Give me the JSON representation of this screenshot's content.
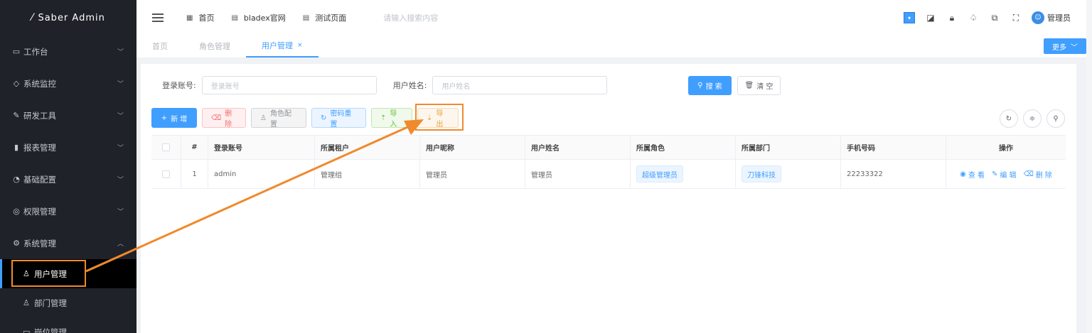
{
  "app": {
    "title": "Saber Admin"
  },
  "sidebar": {
    "items": [
      {
        "label": "工作台",
        "icon": "monitor-icon"
      },
      {
        "label": "系统监控",
        "icon": "shield-icon"
      },
      {
        "label": "研发工具",
        "icon": "wrench-icon"
      },
      {
        "label": "报表管理",
        "icon": "bar-chart-icon"
      },
      {
        "label": "基础配置",
        "icon": "config-icon"
      },
      {
        "label": "权限管理",
        "icon": "lock-icon"
      },
      {
        "label": "系统管理",
        "icon": "gear-icon"
      }
    ],
    "sub_items": [
      {
        "label": "用户管理",
        "icon": "user-icon"
      },
      {
        "label": "部门管理",
        "icon": "team-icon"
      },
      {
        "label": "岗位管理",
        "icon": "post-icon"
      }
    ]
  },
  "header": {
    "nav": [
      {
        "label": "首页",
        "icon": "grid-icon"
      },
      {
        "label": "bladex官网",
        "icon": "doc-icon"
      },
      {
        "label": "测试页面",
        "icon": "doc-icon"
      }
    ],
    "search_placeholder": "请输入搜索内容",
    "user_name": "管理员"
  },
  "tabs": [
    {
      "label": "首页"
    },
    {
      "label": "角色管理"
    },
    {
      "label": "用户管理"
    }
  ],
  "more_label": "更多",
  "form": {
    "account_label": "登录账号:",
    "account_placeholder": "登录账号",
    "name_label": "用户姓名:",
    "name_placeholder": "用户姓名",
    "search_btn": "搜 索",
    "clear_btn": "清 空"
  },
  "toolbar": {
    "add": "新 增",
    "delete": "删 除",
    "role": "角色配置",
    "reset": "密码重置",
    "import": "导入",
    "export": "导出"
  },
  "table": {
    "headers": [
      "#",
      "登录账号",
      "所属租户",
      "用户昵称",
      "用户姓名",
      "所属角色",
      "所属部门",
      "手机号码",
      "操作"
    ],
    "rows": [
      {
        "index": "1",
        "account": "admin",
        "tenant": "管理组",
        "nickname": "管理员",
        "realname": "管理员",
        "role": "超级管理员",
        "dept": "刀锋科技",
        "phone": "22233322",
        "ops": [
          "查 看",
          "编 辑",
          "删 除"
        ]
      }
    ]
  },
  "colors": {
    "sidebar_bg": "#20222a",
    "primary": "#409eff",
    "annotation": "#f08a2c"
  }
}
